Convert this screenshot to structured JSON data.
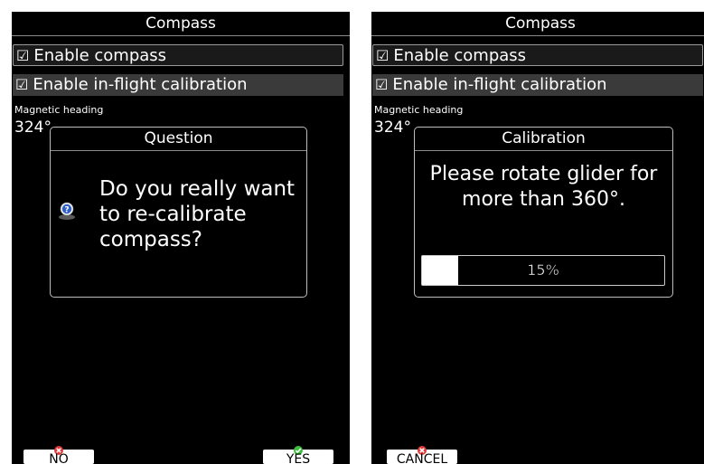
{
  "left_screen": {
    "title": "Compass",
    "options": [
      {
        "checkbox": "☑",
        "label": "Enable compass"
      },
      {
        "checkbox": "☑",
        "label": "Enable in-flight calibration"
      }
    ],
    "magnetic_heading_label": "Magnetic heading",
    "magnetic_heading_value": "324°",
    "dialog": {
      "title": "Question",
      "icon": "question-icon",
      "message": "Do you really want to re-calibrate compass?"
    },
    "buttons": {
      "no": {
        "label": "NO",
        "icon": "red-x-icon"
      },
      "yes": {
        "label": "YES",
        "icon": "green-check-icon"
      }
    }
  },
  "right_screen": {
    "title": "Compass",
    "options": [
      {
        "checkbox": "☑",
        "label": "Enable compass"
      },
      {
        "checkbox": "☑",
        "label": "Enable in-flight calibration"
      }
    ],
    "magnetic_heading_label": "Magnetic heading",
    "magnetic_heading_value": "324°",
    "dialog": {
      "title": "Calibration",
      "message": "Please rotate glider for more than 360°.",
      "progress_label": "15%",
      "progress_value": 0.15
    },
    "buttons": {
      "cancel": {
        "label": "CANCEL",
        "icon": "red-x-icon"
      }
    }
  },
  "colors": {
    "screen_bg": "#000000",
    "text": "#ffffff",
    "dialog_border": "#bdbdbd",
    "selected_row": "#3a3a3a",
    "icon_red": "#e23a3a",
    "icon_green": "#3fbf3f"
  }
}
